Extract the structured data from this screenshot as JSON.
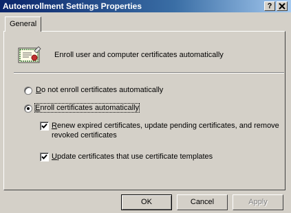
{
  "window": {
    "title": "Autoenrollment Settings Properties",
    "help_label": "?",
    "close_label": "x"
  },
  "tabs": [
    {
      "label": "General",
      "selected": true
    }
  ],
  "intro": {
    "icon": "certificate-icon",
    "text": "Enroll user and computer certificates automatically"
  },
  "options": {
    "do_not_enroll": {
      "accel": "D",
      "label_rest": "o not enroll certificates automatically",
      "selected": false
    },
    "enroll": {
      "accel": "E",
      "label_rest": "nroll certificates automatically",
      "selected": true
    },
    "renew": {
      "accel": "R",
      "label_rest_line1": "enew expired certificates, update pending certificates, and remove",
      "label_line2": "revoked certificates",
      "checked": true
    },
    "update": {
      "accel": "U",
      "label_rest": "pdate certificates that use certificate templates",
      "checked": true
    }
  },
  "buttons": {
    "ok": "OK",
    "cancel": "Cancel",
    "apply": "Apply"
  }
}
